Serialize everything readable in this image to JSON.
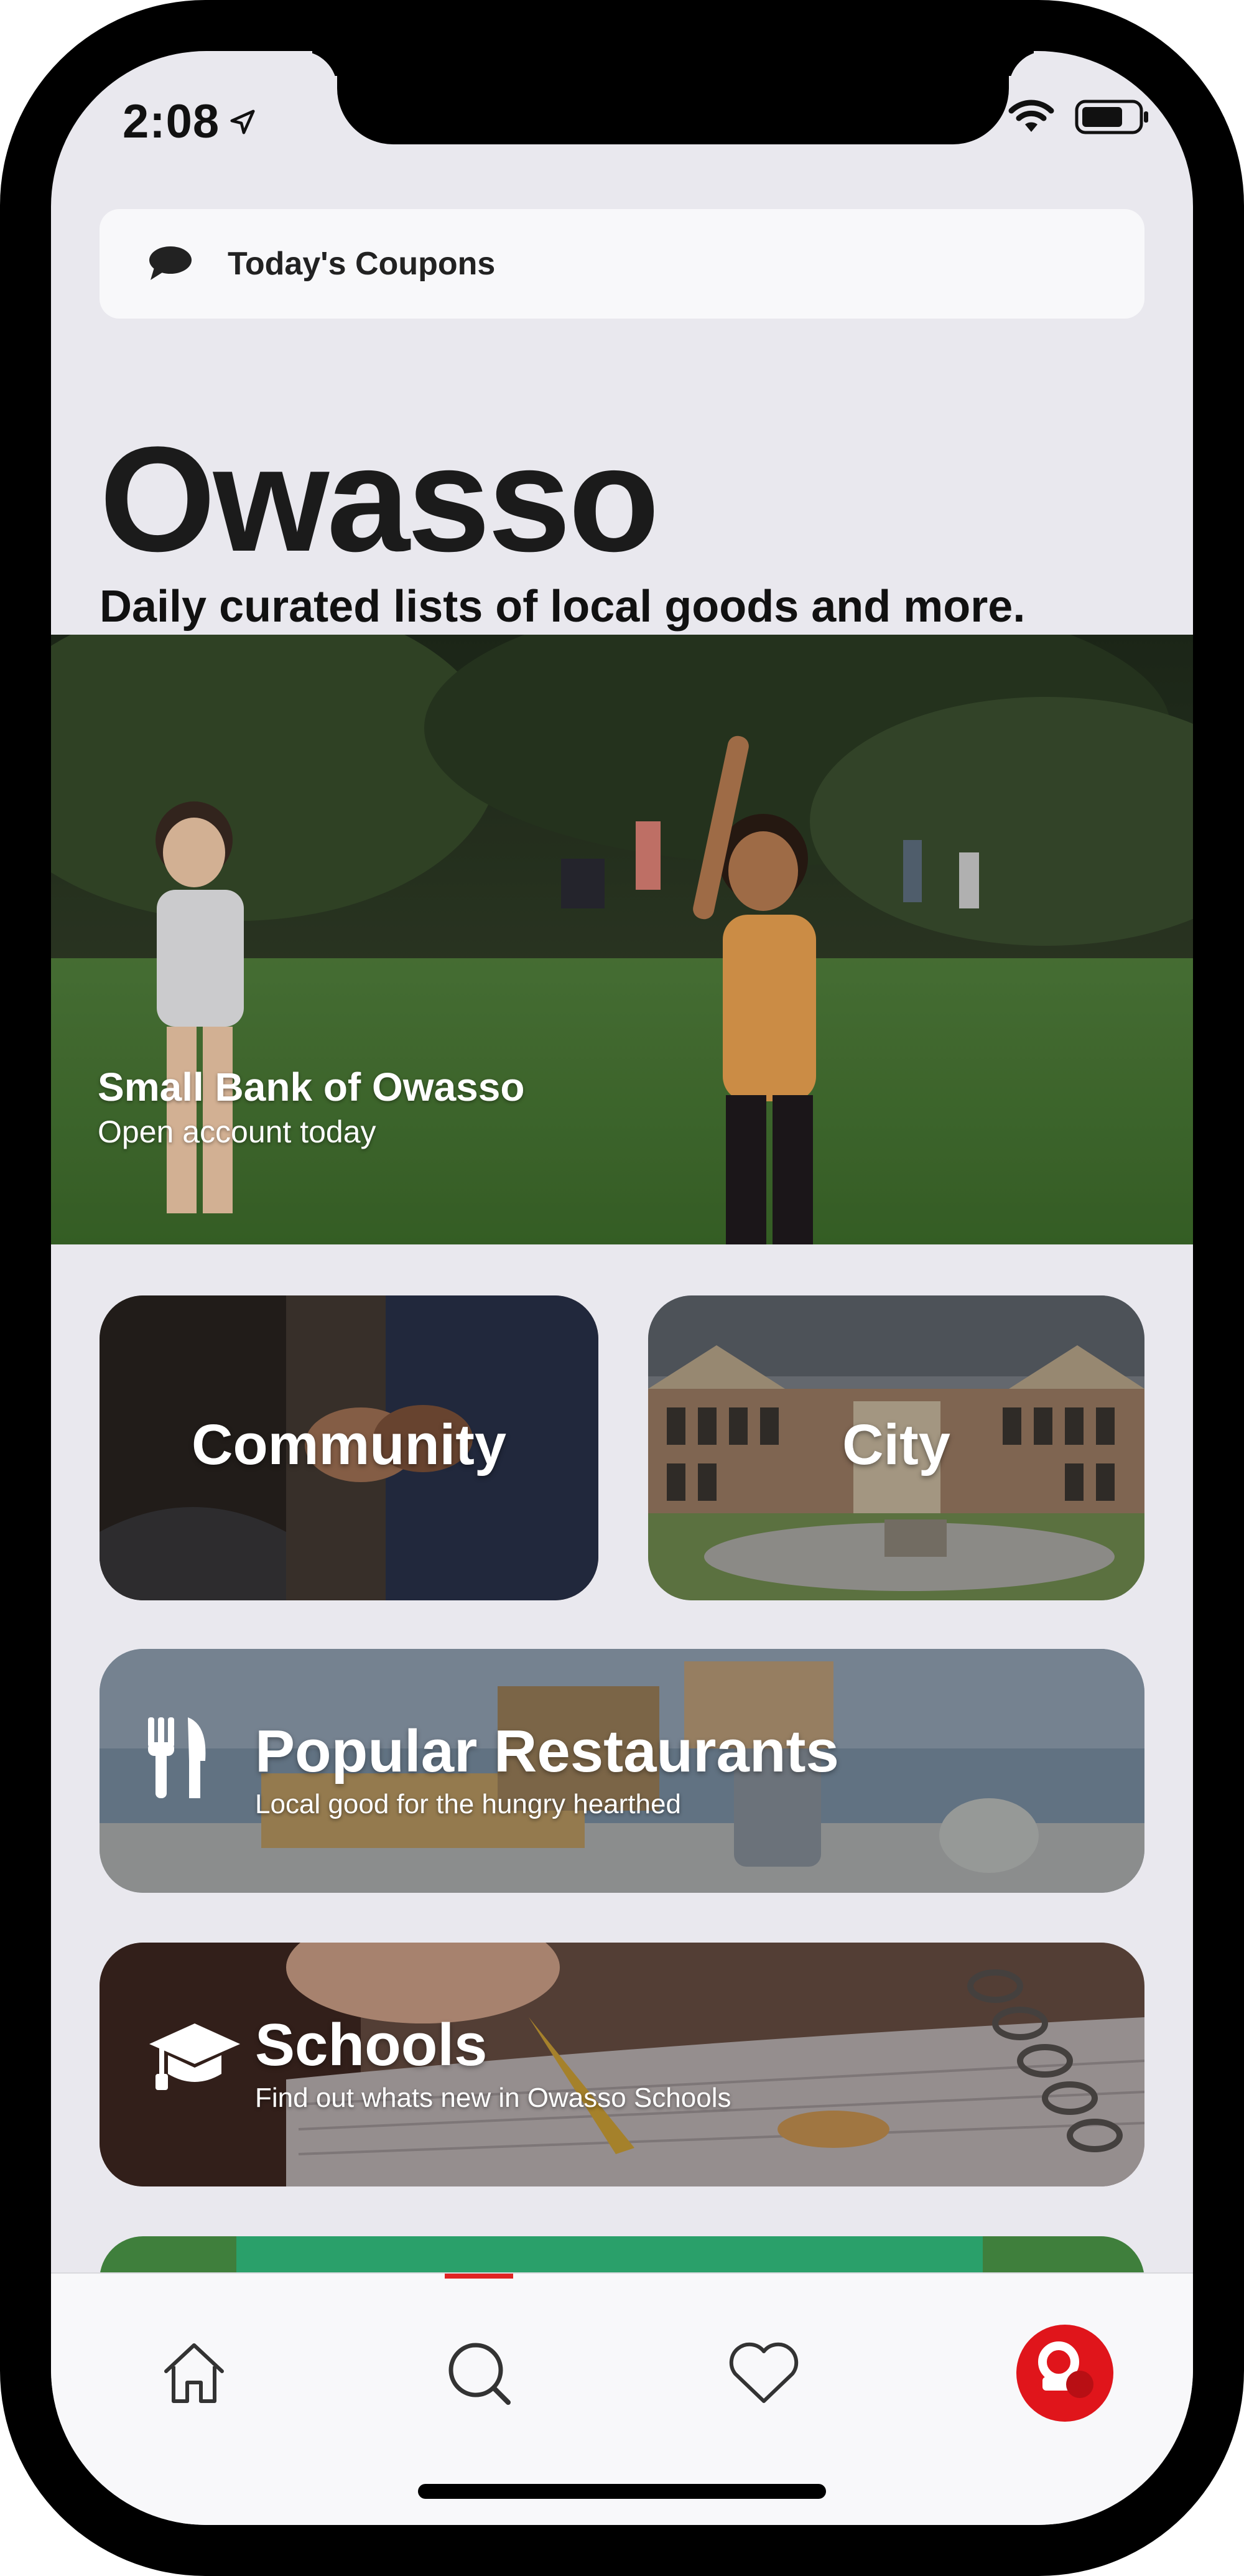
{
  "status_bar": {
    "time": "2:08"
  },
  "coupons": {
    "label": "Today's Coupons",
    "icon": "speech-bubble-icon"
  },
  "header": {
    "title": "Owasso",
    "subtitle": "Daily curated lists of local goods and more."
  },
  "hero": {
    "title": "Small Bank of Owasso",
    "subtitle": "Open account today"
  },
  "categories": {
    "community": "Community",
    "city": "City"
  },
  "lists": [
    {
      "title": "Popular Restaurants",
      "subtitle": "Local good for the hungry hearthed",
      "icon": "fork-knife-icon"
    },
    {
      "title": "Schools",
      "subtitle": "Find out whats new in Owasso Schools",
      "icon": "graduation-cap-icon"
    }
  ],
  "tabbar": {
    "items": [
      "home-icon",
      "search-icon",
      "heart-icon",
      "profile-avatar"
    ],
    "active_index": 1,
    "accent_color": "#e02323"
  }
}
